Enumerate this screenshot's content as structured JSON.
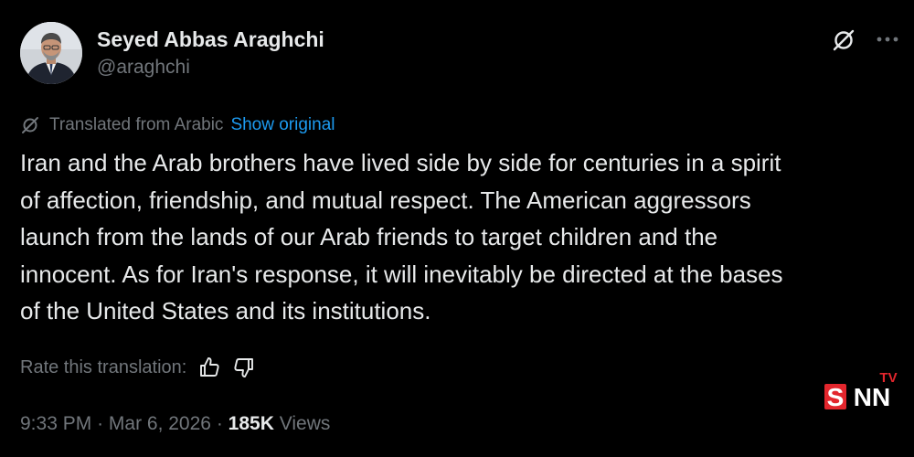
{
  "author": {
    "name": "Seyed Abbas Araghchi",
    "handle": "@araghchi"
  },
  "translation": {
    "note": "Translated from Arabic",
    "show_original": "Show original"
  },
  "tweet": {
    "lines": [
      "Iran and the Arab brothers have lived side by side for centuries in a spirit",
      "of affection, friendship, and mutual respect. The American aggressors",
      "launch from the lands of our Arab friends to target children and the",
      "innocent. As for Iran's response, it will inevitably be directed at the bases",
      "of the United States and its institutions."
    ]
  },
  "rate": {
    "label": "Rate this translation:"
  },
  "meta": {
    "time": "9:33 PM",
    "separator": "·",
    "date": "Mar 6, 2026",
    "views_count": "185K",
    "views_label": "Views"
  },
  "watermark": {
    "text": "SNN",
    "superscript": "TV"
  },
  "colors": {
    "background": "#000000",
    "primary_text": "#e7e9ea",
    "secondary_text": "#71767b",
    "link": "#1d9bf0",
    "watermark_red": "#e3262d"
  },
  "icons": {
    "grok": "grok-slash-icon",
    "more": "more-horizontal-icon",
    "translate": "translate-slash-icon",
    "thumbs_up": "thumbs-up-icon",
    "thumbs_down": "thumbs-down-icon"
  }
}
